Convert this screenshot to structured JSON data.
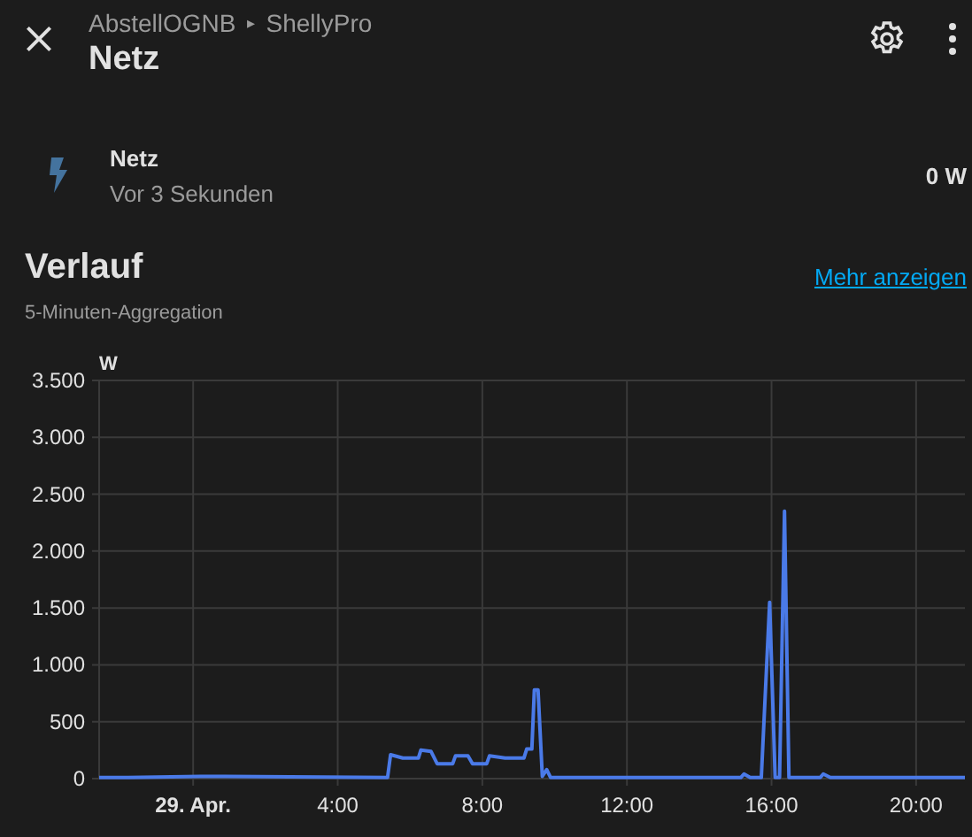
{
  "header": {
    "breadcrumb": [
      "AbstellOGNB",
      "ShellyPro"
    ],
    "separator": "▸",
    "title": "Netz"
  },
  "entity": {
    "name": "Netz",
    "last_changed": "Vor 3 Sekunden",
    "state": "0 W"
  },
  "history": {
    "title": "Verlauf",
    "subtitle": "5-Minuten-Aggregation",
    "link": "Mehr anzeigen",
    "chart_data": {
      "type": "line",
      "grid": true,
      "ylabel": "W",
      "xlim": [
        -2.6,
        21.35
      ],
      "ylim": [
        0,
        3500
      ],
      "yticks": [
        {
          "value": 0,
          "label": "0"
        },
        {
          "value": 500,
          "label": "500"
        },
        {
          "value": 1000,
          "label": "1.000"
        },
        {
          "value": 1500,
          "label": "1.500"
        },
        {
          "value": 2000,
          "label": "2.000"
        },
        {
          "value": 2500,
          "label": "2.500"
        },
        {
          "value": 3000,
          "label": "3.000"
        },
        {
          "value": 3500,
          "label": "3.500"
        }
      ],
      "xticks": [
        {
          "value": 0,
          "label": "29. Apr."
        },
        {
          "value": 4,
          "label": "4:00"
        },
        {
          "value": 8,
          "label": "8:00"
        },
        {
          "value": 12,
          "label": "12:00"
        },
        {
          "value": 16,
          "label": "16:00"
        },
        {
          "value": 20,
          "label": "20:00"
        }
      ],
      "x": [
        -2.6,
        -1.8,
        0.2,
        5.38,
        5.46,
        5.8,
        6.23,
        6.3,
        6.58,
        6.75,
        7.18,
        7.26,
        7.6,
        7.73,
        8.12,
        8.2,
        8.63,
        9.15,
        9.23,
        9.37,
        9.44,
        9.54,
        9.66,
        9.78,
        9.89,
        15.15,
        15.24,
        15.41,
        15.72,
        15.95,
        16.1,
        16.22,
        16.36,
        16.48,
        17.35,
        17.43,
        17.63,
        21.35
      ],
      "series": [
        {
          "color": "#4a7ae8",
          "values": [
            10,
            10,
            20,
            10,
            210,
            180,
            180,
            250,
            240,
            130,
            130,
            200,
            200,
            130,
            130,
            200,
            180,
            180,
            260,
            260,
            780,
            780,
            20,
            80,
            10,
            10,
            40,
            10,
            10,
            1550,
            10,
            10,
            2350,
            10,
            10,
            40,
            10,
            10
          ]
        }
      ]
    }
  }
}
